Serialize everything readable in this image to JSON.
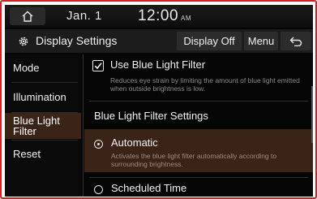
{
  "status": {
    "date": "Jan. 1",
    "time": "12:00",
    "ampm": "AM"
  },
  "header": {
    "title": "Display Settings",
    "display_off_label": "Display Off",
    "menu_label": "Menu"
  },
  "sidebar": {
    "items": [
      {
        "label": "Mode"
      },
      {
        "label": "Illumination"
      },
      {
        "label": "Blue Light Filter",
        "selected": true
      },
      {
        "label": "Reset"
      }
    ]
  },
  "content": {
    "use_filter": {
      "label": "Use Blue Light Filter",
      "checked": true,
      "description": "Reduces eye strain by limiting the amount of blue light emitted when outside brightness is low."
    },
    "section_title": "Blue Light Filter Settings",
    "options": [
      {
        "label": "Automatic",
        "selected": true,
        "description": "Activates the blue light filter automatically according to surrounding brightness."
      },
      {
        "label": "Scheduled Time",
        "selected": false
      }
    ]
  },
  "colors": {
    "accent": "#3a2418",
    "frame": "#d21f2a",
    "background": "#060606"
  }
}
